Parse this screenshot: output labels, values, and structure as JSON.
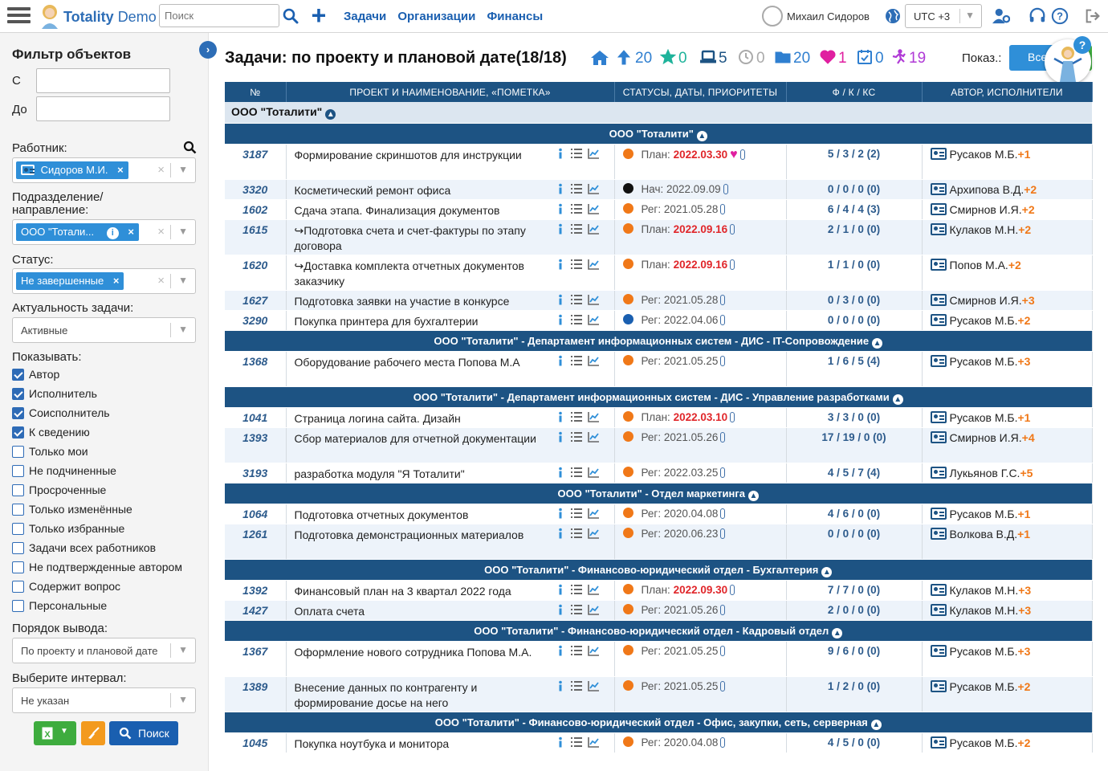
{
  "header": {
    "logo_text": "Totality",
    "logo_demo": "Demo",
    "search_placeholder": "Поиск",
    "nav": [
      "Задачи",
      "Организации",
      "Финансы"
    ],
    "user": "Михаил Сидоров",
    "timezone": "UTC +3"
  },
  "filter": {
    "title": "Фильтр объектов",
    "from_label": "С",
    "to_label": "До",
    "worker_label": "Работник:",
    "worker_chip": "Сидоров М.И.",
    "division_label_1": "Подразделение/",
    "division_label_2": "направление:",
    "division_chip": "ООО \"Тотали...",
    "status_label": "Статус:",
    "status_chip": "Не завершенные",
    "relevance_label": "Актуальность задачи:",
    "relevance_value": "Активные",
    "show_label": "Показывать:",
    "checkboxes": [
      {
        "label": "Автор",
        "checked": true
      },
      {
        "label": "Исполнитель",
        "checked": true
      },
      {
        "label": "Соисполнитель",
        "checked": true
      },
      {
        "label": "К сведению",
        "checked": true
      },
      {
        "label": "Только мои",
        "checked": false
      },
      {
        "label": "Не подчиненные",
        "checked": false
      },
      {
        "label": "Просроченные",
        "checked": false
      },
      {
        "label": "Только изменённые",
        "checked": false
      },
      {
        "label": "Только избранные",
        "checked": false
      },
      {
        "label": "Задачи всех работников",
        "checked": false
      },
      {
        "label": "Не подтвержденные автором",
        "checked": false
      },
      {
        "label": "Содержит вопрос",
        "checked": false
      },
      {
        "label": "Персональные",
        "checked": false
      }
    ],
    "order_label": "Порядок вывода:",
    "order_value": "По проекту и плановой дате",
    "interval_label": "Выберите интервал:",
    "interval_value": "Не указан",
    "search_button": "Поиск"
  },
  "page": {
    "title": "Задачи: по проекту и плановой дате(18/18)",
    "stats": [
      {
        "icon": "up-arrow-icon",
        "value": "20",
        "color": "#2f7fd0"
      },
      {
        "icon": "star-icon",
        "value": "0",
        "color": "#1fb39b"
      },
      {
        "icon": "laptop-icon",
        "value": "5",
        "color": "#1d5383"
      },
      {
        "icon": "clock-icon",
        "value": "0",
        "color": "#aaaaaa"
      },
      {
        "icon": "folder-icon",
        "value": "20",
        "color": "#2f7fd0"
      },
      {
        "icon": "heart-icon",
        "value": "1",
        "color": "#e01fa0"
      },
      {
        "icon": "calendar-check-icon",
        "value": "0",
        "color": "#2f7fd0"
      },
      {
        "icon": "runner-icon",
        "value": "19",
        "color": "#b03ad6"
      }
    ],
    "show_label": "Показ.:",
    "all_button": "Все"
  },
  "table": {
    "columns": [
      "№",
      "ПРОЕКТ И НАИМЕНОВАНИЕ, «ПОМЕТКА»",
      "СТАТУСЫ, ДАТЫ, ПРИОРИТЕТЫ",
      "Ф / К / КС",
      "АВТОР, ИСПОЛНИТЕЛИ"
    ],
    "top_group": "ООО \"Тоталити\"",
    "rows": [
      {
        "type": "group",
        "title": "ООО \"Тоталити\""
      },
      {
        "type": "task",
        "id": "3187",
        "name": "Формирование скриншотов для инструкции",
        "dot": "#f07818",
        "kind": "План:",
        "date": "2022.03.30",
        "overdue": true,
        "heart": true,
        "fk": "5 / 3 / 2 (2)",
        "author": "Русаков М.Б.",
        "extra": "+1"
      },
      {
        "type": "task",
        "id": "3320",
        "name": "Косметический ремонт офиса",
        "dot": "#111111",
        "kind": "Нач:",
        "date": "2022.09.09",
        "overdue": false,
        "fk": "0 / 0 / 0 (0)",
        "author": "Архипова В.Д.",
        "extra": "+2"
      },
      {
        "type": "task",
        "id": "1602",
        "name": "Сдача этапа. Финализация документов",
        "dot": "#f07818",
        "kind": "Рег:",
        "date": "2021.05.28",
        "overdue": false,
        "fk": "6 / 4 / 4 (3)",
        "author": "Смирнов И.Я.",
        "extra": "+2"
      },
      {
        "type": "task",
        "id": "1615",
        "name": "↪Подготовка счета и счет-фактуры по этапу договора",
        "dot": "#f07818",
        "kind": "План:",
        "date": "2022.09.16",
        "overdue": true,
        "fk": "2 / 1 / 0 (0)",
        "author": "Кулаков М.Н.",
        "extra": "+2"
      },
      {
        "type": "task",
        "id": "1620",
        "name": "↪Доставка комплекта отчетных документов заказчику",
        "dot": "#f07818",
        "kind": "План:",
        "date": "2022.09.16",
        "overdue": true,
        "fk": "1 / 1 / 0 (0)",
        "author": "Попов М.А.",
        "extra": "+2"
      },
      {
        "type": "task",
        "id": "1627",
        "name": "Подготовка заявки на участие в конкурсе",
        "dot": "#f07818",
        "kind": "Рег:",
        "date": "2021.05.28",
        "overdue": false,
        "fk": "0 / 3 / 0 (0)",
        "author": "Смирнов И.Я.",
        "extra": "+3"
      },
      {
        "type": "task",
        "id": "3290",
        "name": "Покупка принтера для бухгалтерии",
        "dot": "#1a5fb0",
        "kind": "Рег:",
        "date": "2022.04.06",
        "overdue": false,
        "fk": "0 / 0 / 0 (0)",
        "author": "Русаков М.Б.",
        "extra": "+2"
      },
      {
        "type": "group",
        "title": "ООО \"Тоталити\" - Департамент информационных систем - ДИС - IT-Сопровождение"
      },
      {
        "type": "task",
        "id": "1368",
        "name": "Оборудование рабочего места Попова М.А",
        "dot": "#f07818",
        "kind": "Рег:",
        "date": "2021.05.25",
        "overdue": false,
        "fk": "1 / 6 / 5 (4)",
        "author": "Русаков М.Б.",
        "extra": "+3"
      },
      {
        "type": "group",
        "title": "ООО \"Тоталити\" - Департамент информационных систем - ДИС - Управление разработками"
      },
      {
        "type": "task",
        "id": "1041",
        "name": "Страница логина сайта. Дизайн",
        "dot": "#f07818",
        "kind": "План:",
        "date": "2022.03.10",
        "overdue": true,
        "fk": "3 / 3 / 0 (0)",
        "author": "Русаков М.Б.",
        "extra": "+1"
      },
      {
        "type": "task",
        "id": "1393",
        "name": "Сбор материалов для отчетной документации",
        "dot": "#f07818",
        "kind": "Рег:",
        "date": "2021.05.26",
        "overdue": false,
        "fk": "17 / 19 / 0 (0)",
        "author": "Смирнов И.Я.",
        "extra": "+4"
      },
      {
        "type": "task",
        "id": "3193",
        "name": "разработка модуля \"Я Тоталити\"",
        "dot": "#f07818",
        "kind": "Рег:",
        "date": "2022.03.25",
        "overdue": false,
        "fk": "4 / 5 / 7 (4)",
        "author": "Лукьянов Г.С.",
        "extra": "+5"
      },
      {
        "type": "group",
        "title": "ООО \"Тоталити\" - Отдел маркетинга"
      },
      {
        "type": "task",
        "id": "1064",
        "name": "Подготовка отчетных документов",
        "dot": "#f07818",
        "kind": "Рег:",
        "date": "2020.04.08",
        "overdue": false,
        "fk": "4 / 6 / 0 (0)",
        "author": "Русаков М.Б.",
        "extra": "+1"
      },
      {
        "type": "task",
        "id": "1261",
        "name": "Подготовка демонстрационных материалов",
        "dot": "#f07818",
        "kind": "Рег:",
        "date": "2020.06.23",
        "overdue": false,
        "fk": "0 / 0 / 0 (0)",
        "author": "Волкова В.Д.",
        "extra": "+1"
      },
      {
        "type": "group",
        "title": "ООО \"Тоталити\" - Финансово-юридический отдел - Бухгалтерия"
      },
      {
        "type": "task",
        "id": "1392",
        "name": "Финансовый план на 3 квартал 2022 года",
        "dot": "#f07818",
        "kind": "План:",
        "date": "2022.09.30",
        "overdue": true,
        "fk": "7 / 7 / 0 (0)",
        "author": "Кулаков М.Н.",
        "extra": "+3"
      },
      {
        "type": "task",
        "id": "1427",
        "name": "Оплата счета",
        "dot": "#f07818",
        "kind": "Рег:",
        "date": "2021.05.26",
        "overdue": false,
        "fk": "2 / 0 / 0 (0)",
        "author": "Кулаков М.Н.",
        "extra": "+3"
      },
      {
        "type": "group",
        "title": "ООО \"Тоталити\" - Финансово-юридический отдел - Кадровый отдел"
      },
      {
        "type": "task",
        "id": "1367",
        "name": "Оформление нового сотрудника Попова М.А.",
        "dot": "#f07818",
        "kind": "Рег:",
        "date": "2021.05.25",
        "overdue": false,
        "fk": "9 / 6 / 0 (0)",
        "author": "Русаков М.Б.",
        "extra": "+3"
      },
      {
        "type": "task",
        "id": "1389",
        "name": "Внесение данных по контрагенту и формирование досье на него",
        "dot": "#f07818",
        "kind": "Рег:",
        "date": "2021.05.25",
        "overdue": false,
        "fk": "1 / 2 / 0 (0)",
        "author": "Русаков М.Б.",
        "extra": "+2"
      },
      {
        "type": "group",
        "title": "ООО \"Тоталити\" - Финансово-юридический отдел - Офис, закупки, сеть, серверная"
      },
      {
        "type": "task",
        "id": "1045",
        "name": "Покупка ноутбука и монитора",
        "dot": "#f07818",
        "kind": "Рег:",
        "date": "2020.04.08",
        "overdue": false,
        "fk": "4 / 5 / 0 (0)",
        "author": "Русаков М.Б.",
        "extra": "+2"
      }
    ]
  }
}
